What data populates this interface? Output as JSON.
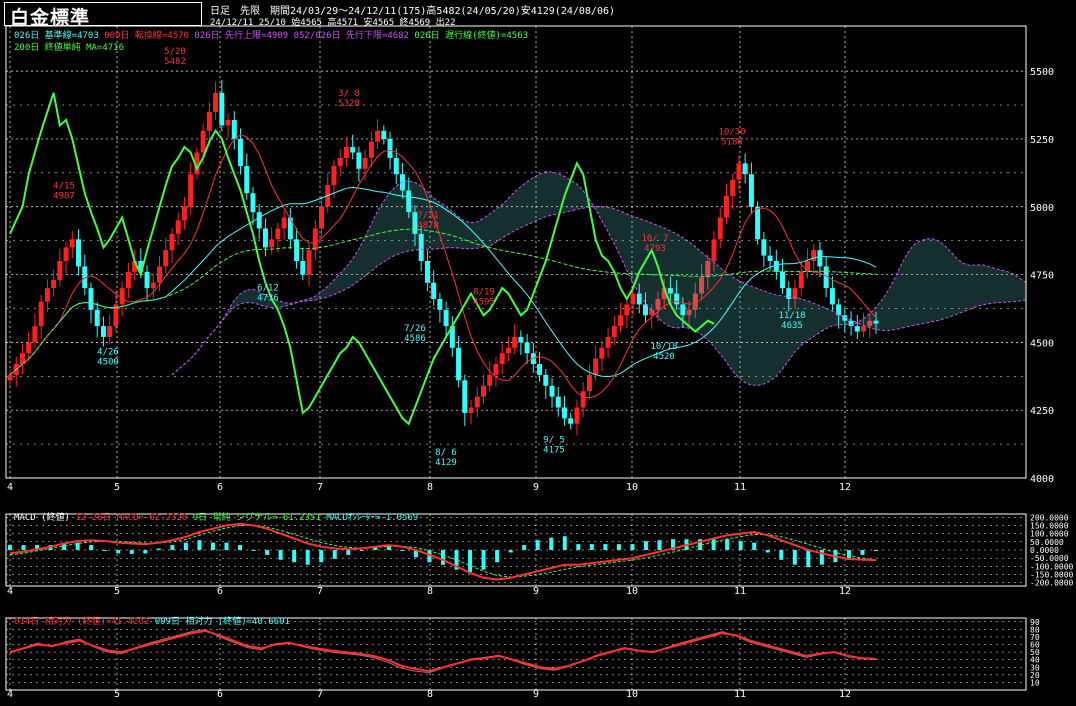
{
  "header": {
    "title": "白金標準",
    "info_line1": "日足　先限　期間24/03/29～24/12/11(175)高5482(24/05/20)安4129(24/08/06)",
    "info_line2": "24/12/11 25/10 始4565 高4571 安4565 終4569 出22"
  },
  "legends": {
    "main": [
      {
        "text": "026日 基準線=4703",
        "color": "#40ffff"
      },
      {
        "text": "009日 転換線=4570",
        "color": "#ff3030"
      },
      {
        "text": "026日 先行上限=4909",
        "color": "#d050ff"
      },
      {
        "text": "052/026日 先行下限=4682",
        "color": "#d050ff"
      },
      {
        "text": "026日 遅行線(終値)=4563",
        "color": "#40ff40"
      }
    ],
    "main2": [
      {
        "text": "200日 終値単純 MA=4716",
        "color": "#40ff40"
      }
    ],
    "macd": [
      {
        "text": "MACD (終値)",
        "color": "#ffffff"
      },
      {
        "text": "12-26日 MACD=-62.2320",
        "color": "#ff3030"
      },
      {
        "text": "9日 単純 シグナル=-61.2351",
        "color": "#40ff40"
      },
      {
        "text": "MACDｵｼﾚｰﾀｰ=-1.0569",
        "color": "#40ffff"
      }
    ],
    "rsi": [
      {
        "text": "014日 相対力 (終値)=41.4202",
        "color": "#ff3030"
      },
      {
        "text": "009日 相対力 (終値)=40.6601",
        "color": "#40ffff"
      }
    ]
  },
  "colors": {
    "bg": "#000000",
    "grid": "#ffffff",
    "up": "#ff2020",
    "down": "#30ffff",
    "kijun": "#40ffff",
    "tenkan": "#ff3030",
    "senkou": "#d050ff",
    "chikou": "#40ff40",
    "ma": "#40ff40",
    "annot_high": "#ff3030",
    "annot_low": "#40ffff"
  },
  "chart_data": [
    {
      "type": "candlestick",
      "title": "白金標準",
      "x_tick_labels": [
        "4",
        "5",
        "6",
        "7",
        "8",
        "9",
        "10",
        "11",
        "12"
      ],
      "ylim": [
        4000,
        5600
      ],
      "y_tick_labels": [
        "5500",
        "5250",
        "5000",
        "4750",
        "4500",
        "4250",
        "4000"
      ],
      "grid": true,
      "closes": [
        4380,
        4420,
        4460,
        4500,
        4560,
        4650,
        4700,
        4730,
        4800,
        4850,
        4880,
        4780,
        4700,
        4620,
        4560,
        4520,
        4560,
        4640,
        4700,
        4760,
        4800,
        4760,
        4700,
        4720,
        4780,
        4840,
        4900,
        4950,
        5000,
        5120,
        5200,
        5280,
        5350,
        5420,
        5300,
        5320,
        5250,
        5150,
        5050,
        4980,
        4920,
        4850,
        4880,
        4920,
        4960,
        4880,
        4800,
        4750,
        4840,
        4920,
        5000,
        5080,
        5150,
        5180,
        5220,
        5200,
        5140,
        5180,
        5240,
        5280,
        5250,
        5180,
        5120,
        5060,
        4980,
        4900,
        4800,
        4720,
        4660,
        4620,
        4560,
        4480,
        4360,
        4240,
        4260,
        4300,
        4340,
        4380,
        4420,
        4460,
        4480,
        4520,
        4500,
        4460,
        4420,
        4380,
        4340,
        4300,
        4260,
        4220,
        4200,
        4260,
        4320,
        4380,
        4440,
        4480,
        4520,
        4560,
        4600,
        4640,
        4680,
        4640,
        4600,
        4620,
        4660,
        4700,
        4680,
        4640,
        4600,
        4620,
        4680,
        4740,
        4800,
        4880,
        4960,
        5040,
        5100,
        5160,
        5120,
        5000,
        4880,
        4820,
        4800,
        4760,
        4700,
        4660,
        4700,
        4760,
        4800,
        4840,
        4780,
        4700,
        4640,
        4600,
        4580,
        4560,
        4540,
        4560,
        4580,
        4569
      ],
      "annotations": [
        {
          "label": "4/15",
          "value": "4987",
          "kind": "high"
        },
        {
          "label": "5/20",
          "value": "5482",
          "kind": "high"
        },
        {
          "label": "3/ 8",
          "value": "5328",
          "kind": "high"
        },
        {
          "label": "7/31",
          "value": "4878",
          "kind": "high"
        },
        {
          "label": "8/19",
          "value": "4595",
          "kind": "high"
        },
        {
          "label": "10/ 7",
          "value": "4793",
          "kind": "high"
        },
        {
          "label": "10/30",
          "value": "5186",
          "kind": "high"
        },
        {
          "label": "4/26",
          "value": "4500",
          "kind": "low"
        },
        {
          "label": "6/12",
          "value": "4736",
          "kind": "low"
        },
        {
          "label": "7/26",
          "value": "4586",
          "kind": "low"
        },
        {
          "label": "8/ 6",
          "value": "4129",
          "kind": "low"
        },
        {
          "label": "9/ 5",
          "value": "4175",
          "kind": "low"
        },
        {
          "label": "10/18",
          "value": "4520",
          "kind": "low"
        },
        {
          "label": "11/18",
          "value": "4635",
          "kind": "low"
        }
      ]
    },
    {
      "type": "line",
      "title": "MACD (終値)",
      "ylim": [
        -220,
        220
      ],
      "y_tick_labels": [
        "200.0000",
        "150.0000",
        "100.0000",
        "50.0000",
        "0.0000",
        "-50.0000",
        "-100.0000",
        "-150.0000",
        "-200.0000"
      ],
      "series": [
        {
          "name": "MACD",
          "values": [
            -20,
            -10,
            5,
            20,
            40,
            55,
            60,
            55,
            45,
            40,
            35,
            45,
            60,
            80,
            110,
            130,
            150,
            160,
            150,
            130,
            100,
            70,
            40,
            20,
            10,
            5,
            10,
            20,
            30,
            20,
            0,
            -30,
            -60,
            -100,
            -140,
            -170,
            -180,
            -170,
            -150,
            -130,
            -110,
            -90,
            -90,
            -80,
            -70,
            -60,
            -50,
            -30,
            -10,
            10,
            30,
            50,
            70,
            90,
            100,
            110,
            90,
            60,
            30,
            0,
            -20,
            -40,
            -55,
            -60,
            -62
          ]
        },
        {
          "name": "シグナル",
          "values": [
            -30,
            -20,
            -5,
            10,
            25,
            40,
            50,
            55,
            52,
            48,
            42,
            42,
            50,
            65,
            90,
            115,
            135,
            150,
            150,
            140,
            120,
            95,
            70,
            45,
            28,
            15,
            12,
            15,
            22,
            22,
            15,
            -5,
            -30,
            -60,
            -95,
            -130,
            -155,
            -165,
            -160,
            -150,
            -135,
            -118,
            -102,
            -92,
            -82,
            -72,
            -62,
            -48,
            -30,
            -12,
            8,
            28,
            48,
            68,
            82,
            95,
            95,
            80,
            60,
            35,
            10,
            -15,
            -35,
            -50,
            -61
          ]
        }
      ]
    },
    {
      "type": "line",
      "title": "相対力 (終値)",
      "ylim": [
        0,
        95
      ],
      "y_tick_labels": [
        "90",
        "80",
        "70",
        "60",
        "50",
        "40",
        "30",
        "20",
        "10"
      ],
      "series": [
        {
          "name": "014日",
          "values": [
            50,
            55,
            60,
            58,
            62,
            65,
            58,
            52,
            50,
            55,
            60,
            65,
            70,
            75,
            78,
            72,
            65,
            58,
            55,
            60,
            62,
            58,
            55,
            52,
            50,
            48,
            45,
            40,
            32,
            28,
            25,
            30,
            35,
            40,
            42,
            45,
            40,
            35,
            30,
            28,
            32,
            38,
            45,
            50,
            55,
            52,
            50,
            55,
            60,
            65,
            70,
            75,
            72,
            65,
            60,
            55,
            50,
            45,
            48,
            50,
            45,
            42,
            41
          ]
        },
        {
          "name": "009日",
          "values": [
            48,
            56,
            62,
            57,
            64,
            67,
            57,
            50,
            48,
            56,
            62,
            67,
            72,
            77,
            80,
            70,
            63,
            56,
            53,
            61,
            63,
            57,
            53,
            50,
            48,
            46,
            43,
            37,
            29,
            25,
            23,
            29,
            35,
            41,
            43,
            46,
            39,
            33,
            28,
            26,
            31,
            38,
            46,
            51,
            56,
            52,
            49,
            56,
            62,
            67,
            72,
            77,
            71,
            63,
            58,
            53,
            48,
            43,
            47,
            50,
            44,
            41,
            40.66
          ]
        }
      ]
    }
  ]
}
